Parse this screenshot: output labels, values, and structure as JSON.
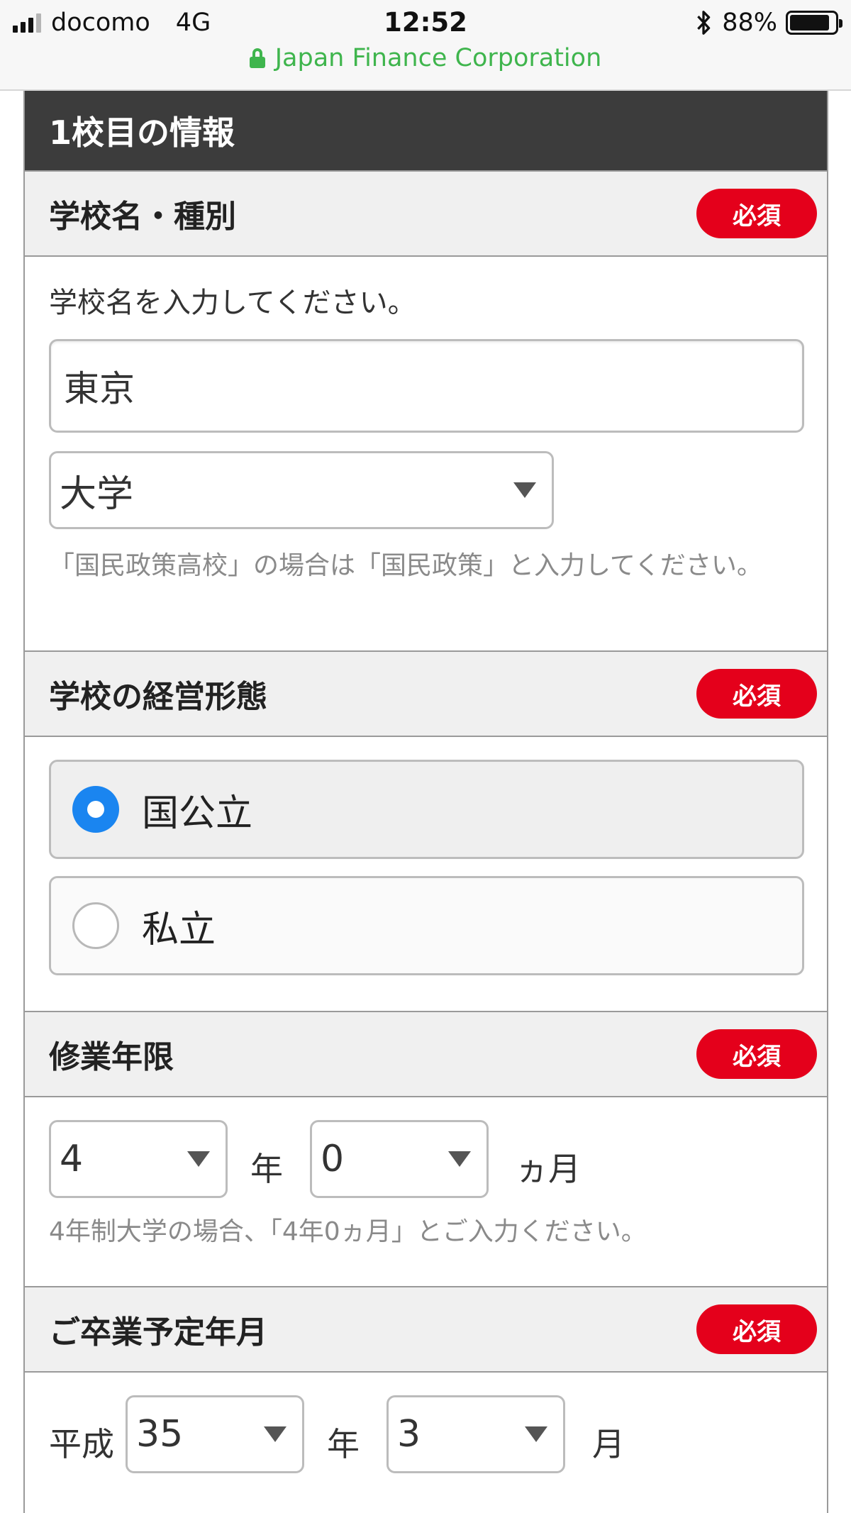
{
  "status_bar": {
    "carrier": "docomo",
    "network": "4G",
    "time": "12:52",
    "battery": "88%",
    "battery_level": 0.88,
    "site_label": "Japan Finance Corporation"
  },
  "form": {
    "title": "1校目の情報",
    "required_label": "必須",
    "school": {
      "heading": "学校名・種別",
      "instruction": "学校名を入力してください。",
      "name_value": "東京",
      "type_value": "大学",
      "note": "「国民政策高校」の場合は「国民政策」と入力してください。"
    },
    "operation": {
      "heading": "学校の経営形態",
      "options": [
        {
          "label": "国公立",
          "selected": true
        },
        {
          "label": "私立",
          "selected": false
        }
      ]
    },
    "duration": {
      "heading": "修業年限",
      "years_value": "4",
      "years_unit": "年",
      "months_value": "0",
      "months_unit": "ヵ月",
      "note": "4年制大学の場合、「4年0ヵ月」とご入力ください。"
    },
    "graduation": {
      "heading": "ご卒業予定年月",
      "era": "平成",
      "year_value": "35",
      "year_unit": "年",
      "month_value": "3",
      "month_unit": "月"
    }
  },
  "colors": {
    "required_badge": "#e4001b",
    "radio_selected": "#1a85f0",
    "secure_url": "#3fb54d",
    "card_title_bg": "#3c3c3c"
  }
}
